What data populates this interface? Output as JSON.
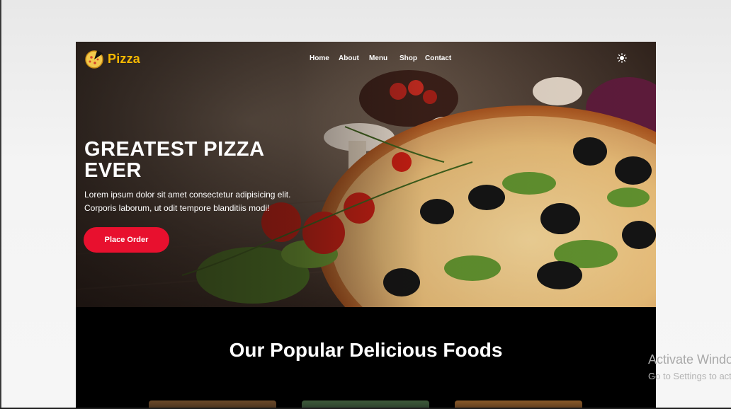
{
  "brand": {
    "name": "Pizza",
    "accent": "#f5b800"
  },
  "nav": {
    "items": [
      {
        "label": "Home"
      },
      {
        "label": "About"
      },
      {
        "label": "Menu"
      },
      {
        "label": "Shop"
      },
      {
        "label": "Contact"
      }
    ],
    "theme_toggle_icon": "sun-icon"
  },
  "hero": {
    "title": "GREATEST PIZZA EVER",
    "text_line1": "Lorem ipsum dolor sit amet consectetur adipisicing elit.",
    "text_line2": "Corporis laborum, ut odit tempore blanditiis modi!",
    "cta_label": "Place Order",
    "cta_color": "#e8102e"
  },
  "popular": {
    "title": "Our Popular Delicious Foods"
  },
  "watermark": {
    "title": "Activate Windows",
    "subtitle": "Go to Settings to activate Windows."
  }
}
